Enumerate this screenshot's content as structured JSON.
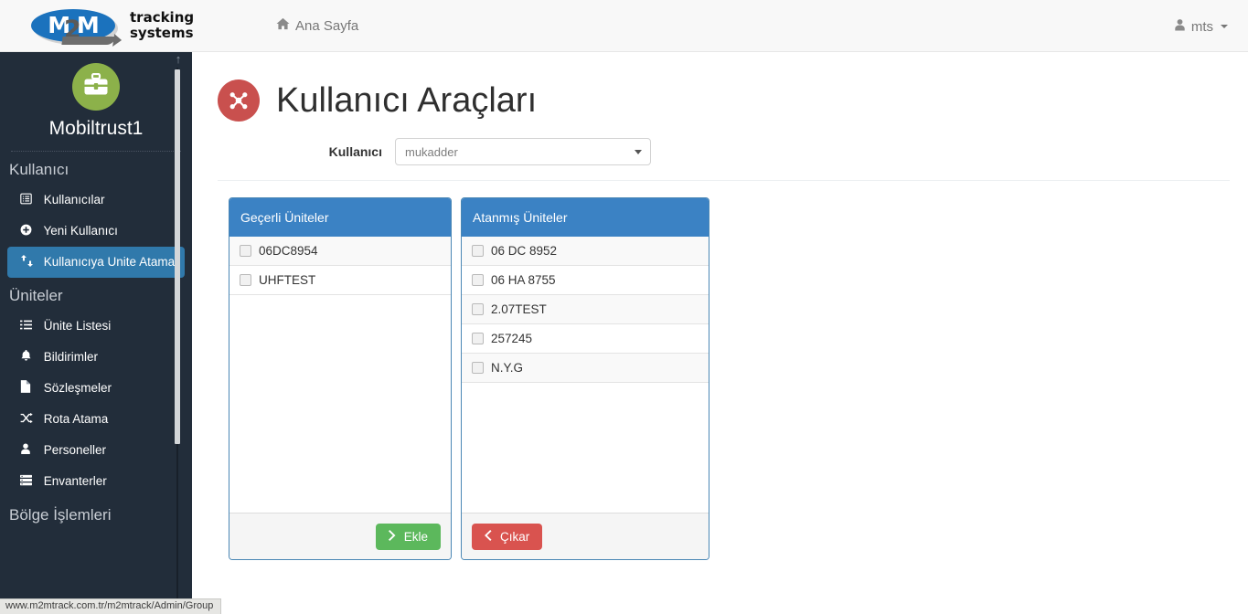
{
  "navbar": {
    "brand": {
      "logo_main": "M M",
      "logo_digit": "2",
      "words_line1": "tracking",
      "words_line2": "systems"
    },
    "home_link": "Ana Sayfa",
    "home_icon": "home-icon",
    "user_label": "mts",
    "user_icon": "user-icon"
  },
  "sidebar": {
    "avatar_icon": "briefcase-icon",
    "profile_name": "Mobiltrust1",
    "groups": [
      {
        "title": "Kullanıcı",
        "items": [
          {
            "label": "Kullanıcılar",
            "icon": "list-alt-icon",
            "active": false
          },
          {
            "label": "Yeni Kullanıcı",
            "icon": "plus-circle-icon",
            "active": false
          },
          {
            "label": "Kullanıcıya Unite Atama",
            "icon": "exchange-icon",
            "active": true
          }
        ]
      },
      {
        "title": "Üniteler",
        "items": [
          {
            "label": "Ünite Listesi",
            "icon": "list-icon",
            "active": false
          },
          {
            "label": "Bildirimler",
            "icon": "bell-icon",
            "active": false
          },
          {
            "label": "Sözleşmeler",
            "icon": "file-icon",
            "active": false
          },
          {
            "label": "Rota Atama",
            "icon": "random-icon",
            "active": false
          },
          {
            "label": "Personeller",
            "icon": "user-icon",
            "active": false
          },
          {
            "label": "Envanterler",
            "icon": "server-icon",
            "active": false
          }
        ]
      },
      {
        "title": "Bölge İşlemleri",
        "items": []
      }
    ],
    "scroll_up_icon": "arrow-up-icon"
  },
  "page": {
    "icon": "sitemap-icon",
    "title": "Kullanıcı Araçları",
    "filter": {
      "label": "Kullanıcı",
      "selected": "mukadder",
      "placeholder": "mukadder",
      "arrow_icon": "chevron-down-icon"
    }
  },
  "panels": [
    {
      "id": "available",
      "title": "Geçerli Üniteler",
      "items": [
        {
          "label": "06DC8954",
          "checked": false
        },
        {
          "label": "UHFTEST",
          "checked": false
        }
      ],
      "button": {
        "label": "Ekle",
        "icon": "chevron-right-icon",
        "style": "green",
        "align": "right"
      }
    },
    {
      "id": "assigned",
      "title": "Atanmış Üniteler",
      "items": [
        {
          "label": "06 DC 8952",
          "checked": false
        },
        {
          "label": "06 HA 8755",
          "checked": false
        },
        {
          "label": "2.07TEST",
          "checked": false
        },
        {
          "label": "257245",
          "checked": false
        },
        {
          "label": "N.Y.G",
          "checked": false
        }
      ],
      "button": {
        "label": "Çıkar",
        "icon": "chevron-left-icon",
        "style": "red",
        "align": "left"
      }
    }
  ],
  "statusbar": {
    "url": "www.m2mtrack.com.tr/m2mtrack/Admin/Group"
  },
  "colors": {
    "sidebar_bg": "#222d3a",
    "sidebar_active": "#3079ab",
    "panel_header": "#3b82c4",
    "page_icon": "#c9504e",
    "avatar": "#8cb14a",
    "btn_green": "#5cb85c",
    "btn_red": "#d9534f"
  }
}
